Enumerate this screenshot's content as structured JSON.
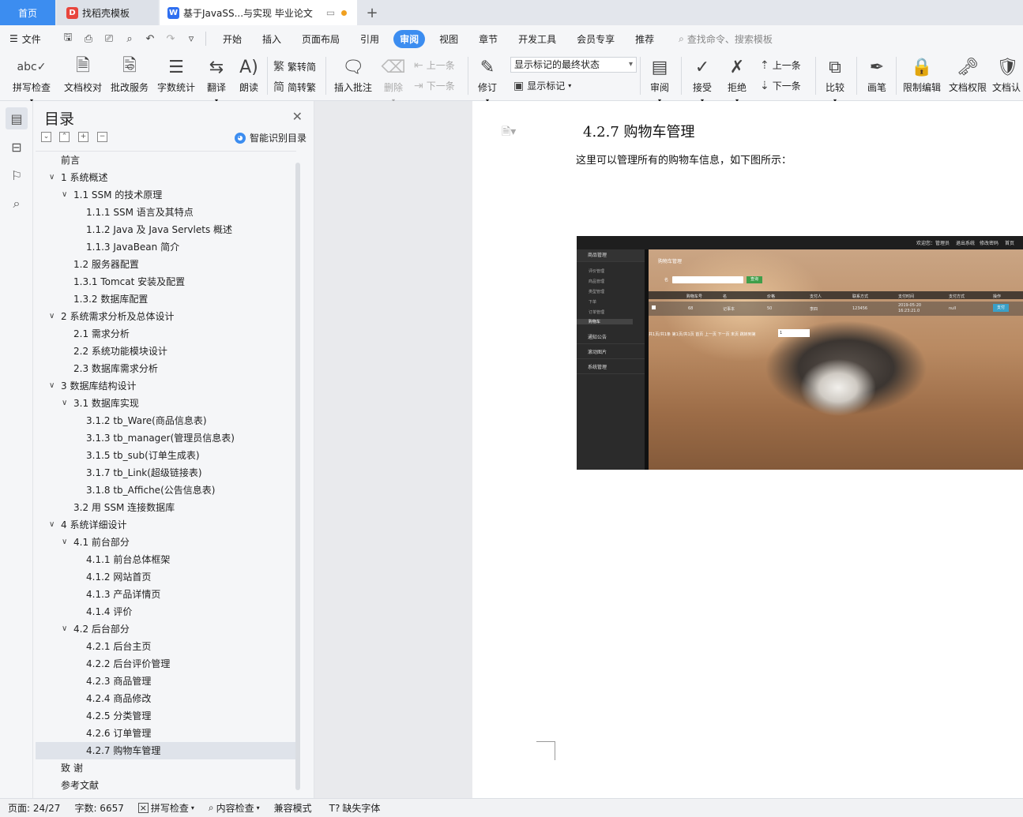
{
  "tabs": {
    "home": "首页",
    "template": "找稻壳模板",
    "document": "基于JavaSS...与实现 毕业论文"
  },
  "menubar": {
    "file": "文件",
    "items": [
      "开始",
      "插入",
      "页面布局",
      "引用",
      "审阅",
      "视图",
      "章节",
      "开发工具",
      "会员专享",
      "推荐"
    ],
    "active": "审阅",
    "search": "查找命令、搜索模板"
  },
  "ribbon": {
    "spell_check": "拼写检查",
    "doc_proof": "文档校对",
    "revise_service": "批改服务",
    "word_count": "字数统计",
    "translate": "翻译",
    "read_aloud": "朗读",
    "to_traditional": "繁转简",
    "to_simplified": "简转繁",
    "insert_comment": "插入批注",
    "delete": "删除",
    "prev_comment": "上一条",
    "next_comment": "下一条",
    "track_changes": "修订",
    "markup_state": "显示标记的最终状态",
    "show_markup": "显示标记",
    "review": "审阅",
    "accept": "接受",
    "reject": "拒绝",
    "prev_change": "上一条",
    "next_change": "下一条",
    "compare": "比较",
    "ink": "画笔",
    "restrict_edit": "限制编辑",
    "doc_permission": "文档权限",
    "doc_cert": "文档认"
  },
  "toc": {
    "title": "目录",
    "smart": "智能识别目录",
    "items": [
      {
        "text": "前言",
        "level": 0,
        "arrow": false
      },
      {
        "text": "1  系统概述",
        "level": 0,
        "arrow": true
      },
      {
        "text": "1.1 SSM 的技术原理",
        "level": 1,
        "arrow": true
      },
      {
        "text": "1.1.1 SSM 语言及其特点",
        "level": 2,
        "arrow": false
      },
      {
        "text": "1.1.2 Java 及 Java Servlets 概述",
        "level": 2,
        "arrow": false
      },
      {
        "text": "1.1.3 JavaBean 简介",
        "level": 2,
        "arrow": false
      },
      {
        "text": "1.2  服务器配置",
        "level": 1,
        "arrow": false
      },
      {
        "text": "1.3.1 Tomcat 安装及配置",
        "level": 1,
        "arrow": false
      },
      {
        "text": "1.3.2  数据库配置",
        "level": 1,
        "arrow": false
      },
      {
        "text": "2  系统需求分析及总体设计",
        "level": 0,
        "arrow": true
      },
      {
        "text": "2.1  需求分析",
        "level": 1,
        "arrow": false
      },
      {
        "text": "2.2  系统功能模块设计",
        "level": 1,
        "arrow": false
      },
      {
        "text": "2.3  数据库需求分析",
        "level": 1,
        "arrow": false
      },
      {
        "text": "3  数据库结构设计",
        "level": 0,
        "arrow": true
      },
      {
        "text": "3.1  数据库实现",
        "level": 1,
        "arrow": true
      },
      {
        "text": "3.1.2 tb_Ware(商品信息表)",
        "level": 2,
        "arrow": false
      },
      {
        "text": "3.1.3 tb_manager(管理员信息表)",
        "level": 2,
        "arrow": false
      },
      {
        "text": "3.1.5 tb_sub(订单生成表)",
        "level": 2,
        "arrow": false
      },
      {
        "text": "3.1.7 tb_Link(超级链接表)",
        "level": 2,
        "arrow": false
      },
      {
        "text": "3.1.8 tb_Affiche(公告信息表)",
        "level": 2,
        "arrow": false
      },
      {
        "text": "3.2  用 SSM 连接数据库",
        "level": 1,
        "arrow": false
      },
      {
        "text": "4  系统详细设计",
        "level": 0,
        "arrow": true
      },
      {
        "text": "4.1  前台部分",
        "level": 1,
        "arrow": true
      },
      {
        "text": "4.1.1  前台总体框架",
        "level": 2,
        "arrow": false
      },
      {
        "text": "4.1.2  网站首页",
        "level": 2,
        "arrow": false
      },
      {
        "text": "4.1.3  产品详情页",
        "level": 2,
        "arrow": false
      },
      {
        "text": "4.1.4  评价",
        "level": 2,
        "arrow": false
      },
      {
        "text": "4.2  后台部分",
        "level": 1,
        "arrow": true
      },
      {
        "text": "4.2.1  后台主页",
        "level": 2,
        "arrow": false
      },
      {
        "text": "4.2.2  后台评价管理",
        "level": 2,
        "arrow": false
      },
      {
        "text": "4.2.3  商品管理",
        "level": 2,
        "arrow": false
      },
      {
        "text": "4.2.4  商品修改",
        "level": 2,
        "arrow": false
      },
      {
        "text": "4.2.5  分类管理",
        "level": 2,
        "arrow": false
      },
      {
        "text": "4.2.6  订单管理",
        "level": 2,
        "arrow": false
      },
      {
        "text": "4.2.7  购物车管理",
        "level": 2,
        "arrow": false,
        "selected": true
      },
      {
        "text": "致    谢",
        "level": 0,
        "arrow": false
      },
      {
        "text": "参考文献",
        "level": 0,
        "arrow": false
      }
    ]
  },
  "document": {
    "heading": "4.2.7  购物车管理",
    "paragraph": "这里可以管理所有的购物车信息，如下图所示：",
    "screenshot": {
      "top_links": [
        "欢迎您：管理员",
        "退出系统",
        "修改密码",
        "首页"
      ],
      "side_groups": [
        "商品管理",
        "通知公告",
        "滚动图片",
        "系统管理"
      ],
      "side_subs": [
        "评价管理",
        "商品管理",
        "类型管理",
        "下单",
        "订单管理",
        "购物车"
      ],
      "panel_title": "购物车管理",
      "search_label": "名",
      "query_button": "查询",
      "columns": [
        "购物车号",
        "名",
        "价格",
        "支付人",
        "联系方式",
        "支付时间",
        "支付方式",
        "操作"
      ],
      "row": [
        "68",
        "记事本",
        "50",
        "李四",
        "123456",
        "2019-05-20 16:23:21.0",
        "null"
      ],
      "row_button": "支付",
      "pager": "共1页/共1条 第1页/共1页 首页 上一页 下一页 末页 跳转到第",
      "pager_value": "1"
    }
  },
  "status": {
    "page": "页面: 24/27",
    "words": "字数: 6657",
    "spell": "拼写检查",
    "content_check": "内容检查",
    "compat": "兼容模式",
    "missing_fonts": "缺失字体"
  }
}
